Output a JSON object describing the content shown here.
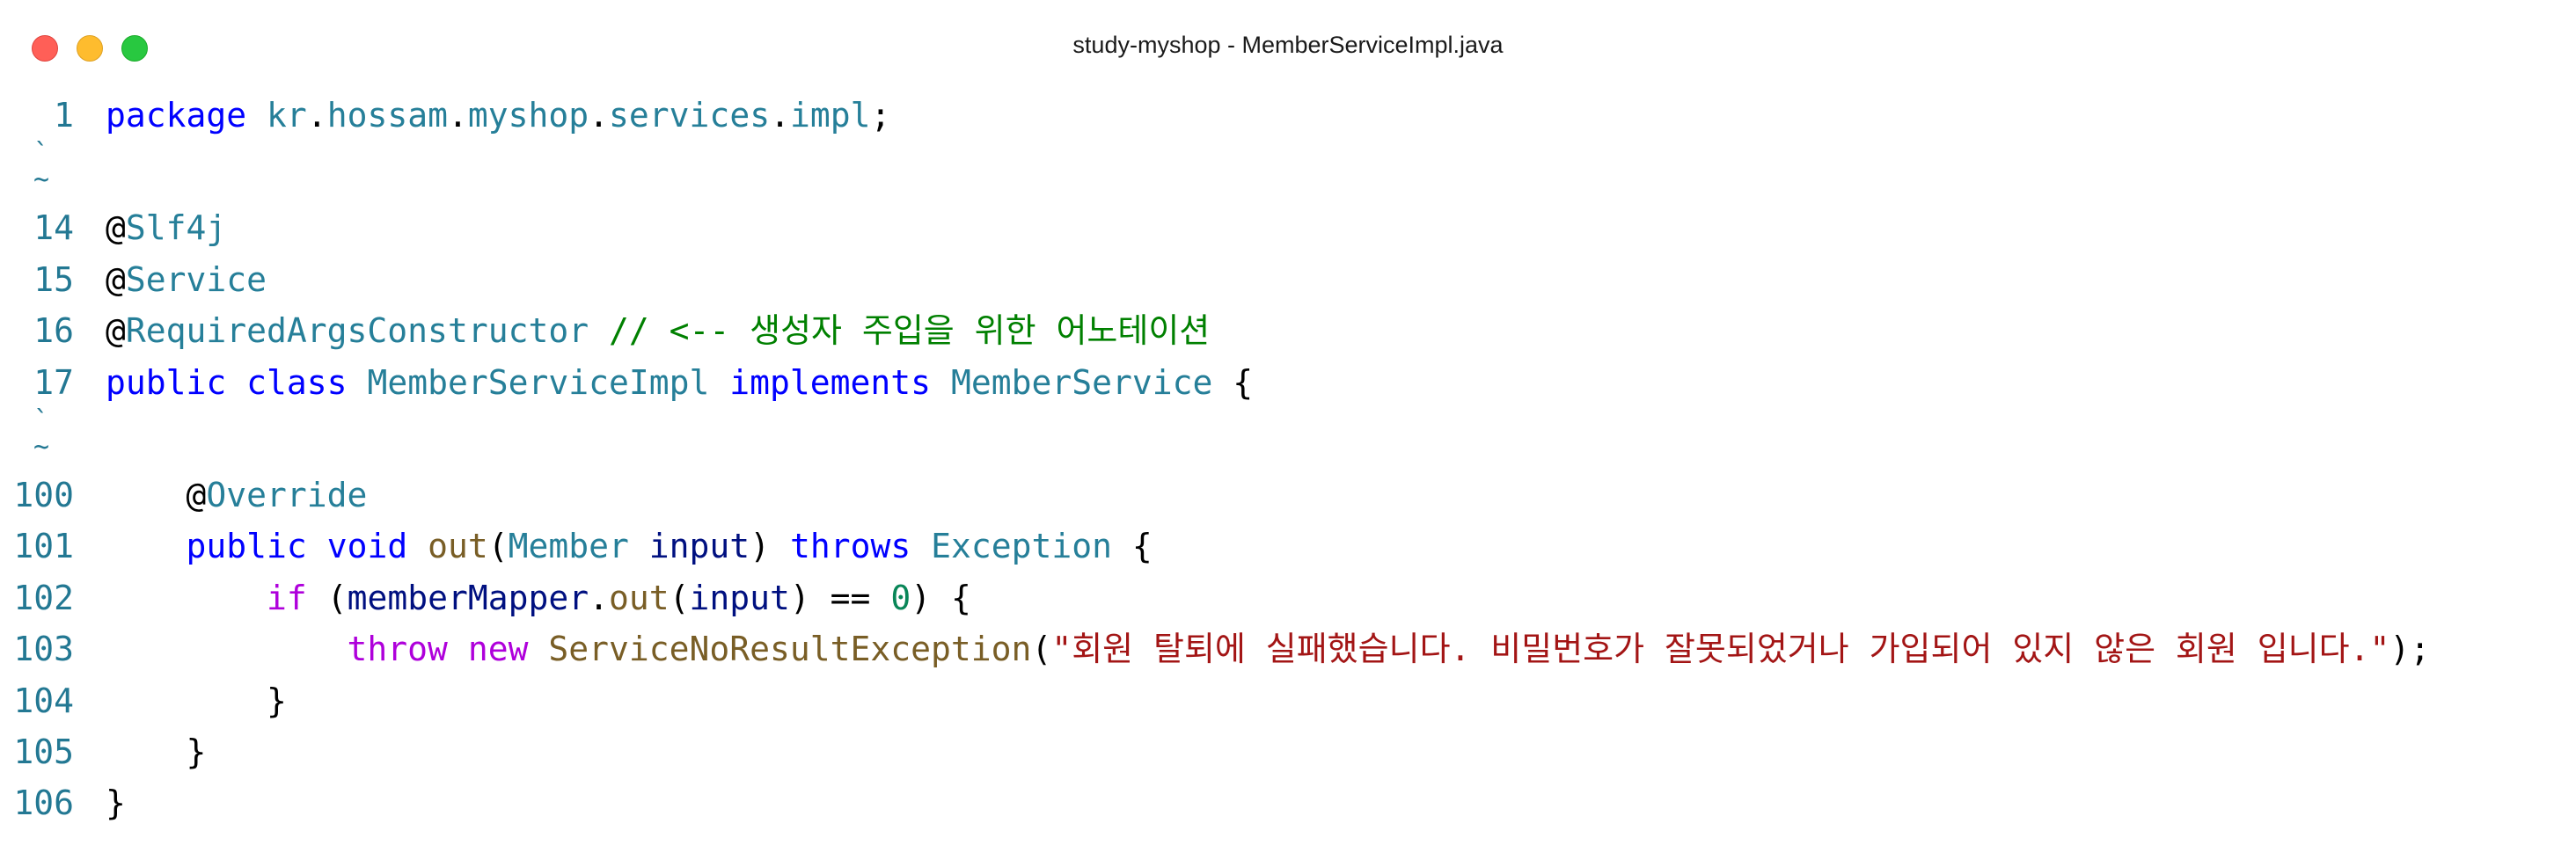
{
  "window": {
    "title": "study-myshop - MemberServiceImpl.java"
  },
  "code": {
    "lines": [
      {
        "n": "1",
        "tokens": [
          {
            "t": "package",
            "c": "kw"
          },
          {
            "t": " ",
            "c": "plain"
          },
          {
            "t": "kr",
            "c": "ty"
          },
          {
            "t": ".",
            "c": "plain"
          },
          {
            "t": "hossam",
            "c": "ty"
          },
          {
            "t": ".",
            "c": "plain"
          },
          {
            "t": "myshop",
            "c": "ty"
          },
          {
            "t": ".",
            "c": "plain"
          },
          {
            "t": "services",
            "c": "ty"
          },
          {
            "t": ".",
            "c": "plain"
          },
          {
            "t": "impl",
            "c": "ty"
          },
          {
            "t": ";",
            "c": "plain"
          }
        ]
      },
      {
        "fold": true
      },
      {
        "n": "14",
        "tokens": [
          {
            "t": "@",
            "c": "plain"
          },
          {
            "t": "Slf4j",
            "c": "ty"
          }
        ]
      },
      {
        "n": "15",
        "tokens": [
          {
            "t": "@",
            "c": "plain"
          },
          {
            "t": "Service",
            "c": "ty"
          }
        ]
      },
      {
        "n": "16",
        "tokens": [
          {
            "t": "@",
            "c": "plain"
          },
          {
            "t": "RequiredArgsConstructor",
            "c": "ty"
          },
          {
            "t": " ",
            "c": "plain"
          },
          {
            "t": "// <-- 생성자 주입을 위한 어노테이션",
            "c": "cm"
          }
        ]
      },
      {
        "n": "17",
        "tokens": [
          {
            "t": "public",
            "c": "kw"
          },
          {
            "t": " ",
            "c": "plain"
          },
          {
            "t": "class",
            "c": "kw"
          },
          {
            "t": " ",
            "c": "plain"
          },
          {
            "t": "MemberServiceImpl",
            "c": "ty"
          },
          {
            "t": " ",
            "c": "plain"
          },
          {
            "t": "implements",
            "c": "kw"
          },
          {
            "t": " ",
            "c": "plain"
          },
          {
            "t": "MemberService",
            "c": "ty"
          },
          {
            "t": " {",
            "c": "plain"
          }
        ]
      },
      {
        "fold": true
      },
      {
        "n": "100",
        "tokens": [
          {
            "t": "    @",
            "c": "plain"
          },
          {
            "t": "Override",
            "c": "ty"
          }
        ]
      },
      {
        "n": "101",
        "tokens": [
          {
            "t": "    ",
            "c": "plain"
          },
          {
            "t": "public",
            "c": "kw"
          },
          {
            "t": " ",
            "c": "plain"
          },
          {
            "t": "void",
            "c": "kw"
          },
          {
            "t": " ",
            "c": "plain"
          },
          {
            "t": "out",
            "c": "fn"
          },
          {
            "t": "(",
            "c": "plain"
          },
          {
            "t": "Member",
            "c": "ty"
          },
          {
            "t": " ",
            "c": "plain"
          },
          {
            "t": "input",
            "c": "var"
          },
          {
            "t": ") ",
            "c": "plain"
          },
          {
            "t": "throws",
            "c": "kw"
          },
          {
            "t": " ",
            "c": "plain"
          },
          {
            "t": "Exception",
            "c": "ty"
          },
          {
            "t": " {",
            "c": "plain"
          }
        ]
      },
      {
        "n": "102",
        "tokens": [
          {
            "t": "        ",
            "c": "plain"
          },
          {
            "t": "if",
            "c": "ctl"
          },
          {
            "t": " (",
            "c": "plain"
          },
          {
            "t": "memberMapper",
            "c": "var"
          },
          {
            "t": ".",
            "c": "plain"
          },
          {
            "t": "out",
            "c": "fn"
          },
          {
            "t": "(",
            "c": "plain"
          },
          {
            "t": "input",
            "c": "var"
          },
          {
            "t": ") == ",
            "c": "plain"
          },
          {
            "t": "0",
            "c": "num"
          },
          {
            "t": ") {",
            "c": "plain"
          }
        ]
      },
      {
        "n": "103",
        "tokens": [
          {
            "t": "            ",
            "c": "plain"
          },
          {
            "t": "throw",
            "c": "ctl"
          },
          {
            "t": " ",
            "c": "plain"
          },
          {
            "t": "new",
            "c": "ctl"
          },
          {
            "t": " ",
            "c": "plain"
          },
          {
            "t": "ServiceNoResultException",
            "c": "fn"
          },
          {
            "t": "(",
            "c": "plain"
          },
          {
            "t": "\"회원 탈퇴에 실패했습니다. 비밀번호가 잘못되었거나 가입되어 있지 않은 회원 입니다.\"",
            "c": "str"
          },
          {
            "t": ");",
            "c": "plain"
          }
        ]
      },
      {
        "n": "104",
        "tokens": [
          {
            "t": "        }",
            "c": "plain"
          }
        ]
      },
      {
        "n": "105",
        "tokens": [
          {
            "t": "    }",
            "c": "plain"
          }
        ]
      },
      {
        "n": "106",
        "tokens": [
          {
            "t": "}",
            "c": "plain"
          }
        ]
      }
    ]
  }
}
